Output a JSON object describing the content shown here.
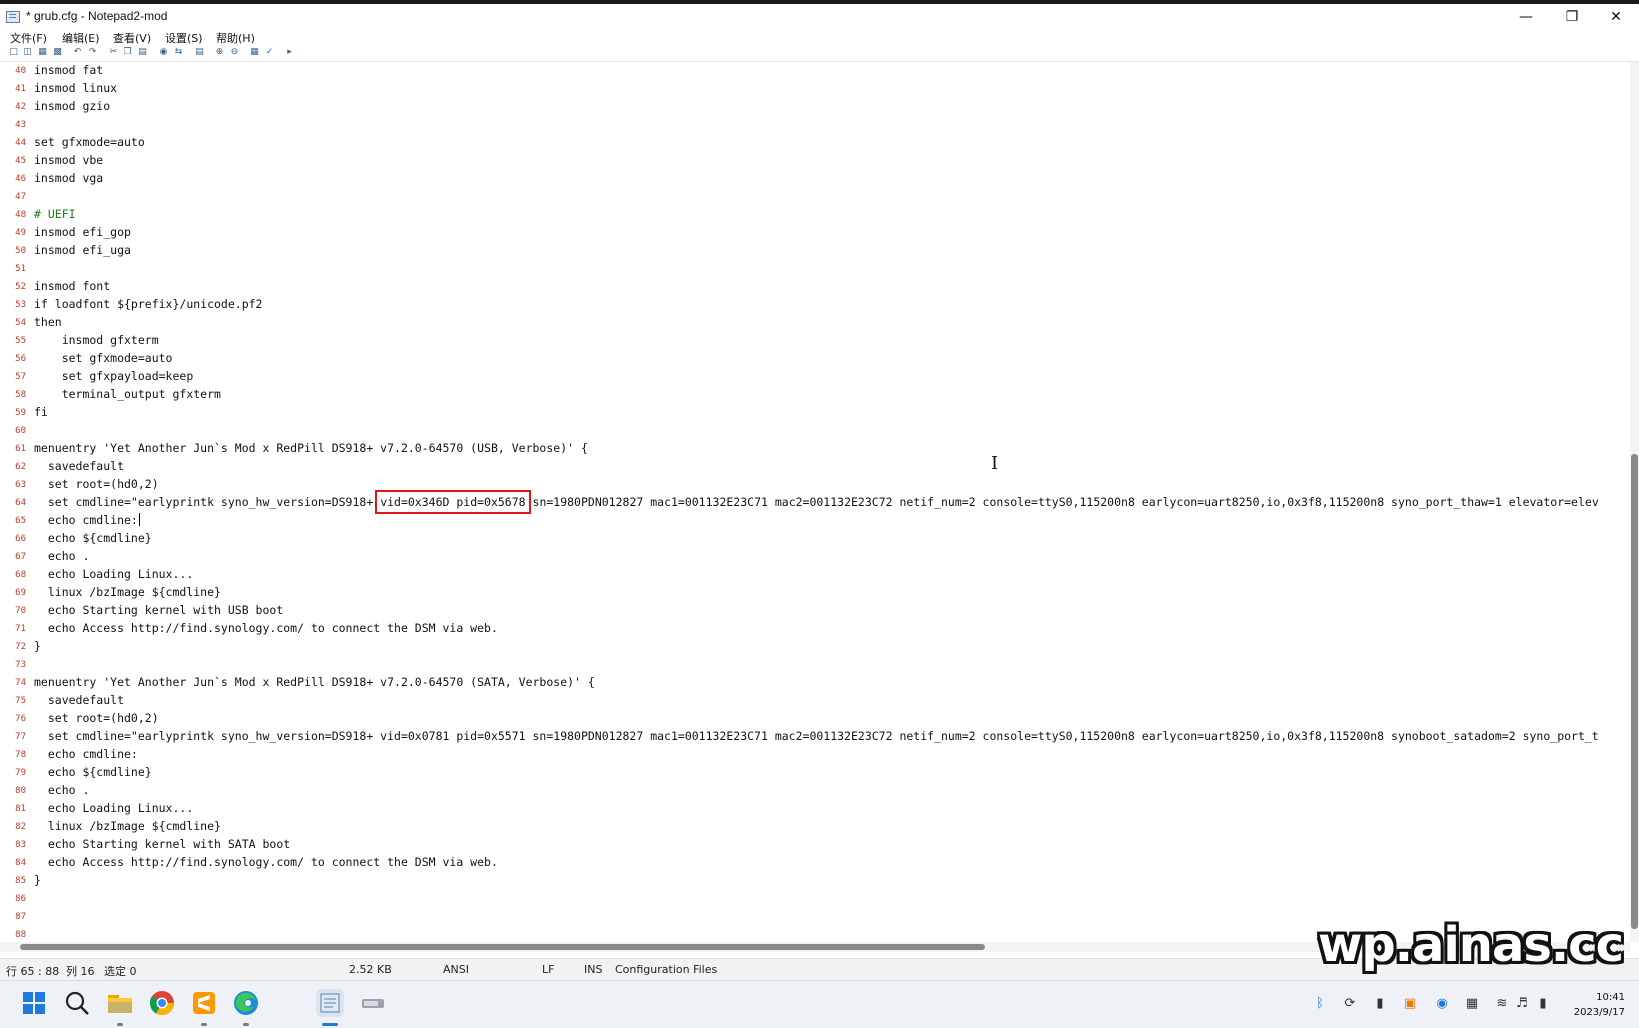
{
  "window": {
    "title": "* grub.cfg - Notepad2-mod"
  },
  "menu": [
    "文件(F)",
    "编辑(E)",
    "查看(V)",
    "设置(S)",
    "帮助(H)"
  ],
  "lines": [
    {
      "n": "40",
      "t": "insmod fat"
    },
    {
      "n": "41",
      "t": "insmod linux"
    },
    {
      "n": "42",
      "t": "insmod gzio"
    },
    {
      "n": "43",
      "t": ""
    },
    {
      "n": "44",
      "t": "set gfxmode=auto"
    },
    {
      "n": "45",
      "t": "insmod vbe"
    },
    {
      "n": "46",
      "t": "insmod vga"
    },
    {
      "n": "47",
      "t": ""
    },
    {
      "n": "48",
      "t": "# UEFI",
      "comment": true
    },
    {
      "n": "49",
      "t": "insmod efi_gop"
    },
    {
      "n": "50",
      "t": "insmod efi_uga"
    },
    {
      "n": "51",
      "t": ""
    },
    {
      "n": "52",
      "t": "insmod font"
    },
    {
      "n": "53",
      "t": "if loadfont ${prefix}/unicode.pf2"
    },
    {
      "n": "54",
      "t": "then"
    },
    {
      "n": "55",
      "t": "    insmod gfxterm"
    },
    {
      "n": "56",
      "t": "    set gfxmode=auto"
    },
    {
      "n": "57",
      "t": "    set gfxpayload=keep"
    },
    {
      "n": "58",
      "t": "    terminal_output gfxterm"
    },
    {
      "n": "59",
      "t": "fi"
    },
    {
      "n": "60",
      "t": ""
    },
    {
      "n": "61",
      "t": "menuentry 'Yet Another Jun`s Mod x RedPill DS918+ v7.2.0-64570 (USB, Verbose)' {"
    },
    {
      "n": "62",
      "t": "  savedefault"
    },
    {
      "n": "63",
      "t": "  set root=(hd0,2)"
    },
    {
      "n": "64",
      "t": "  set cmdline=\"earlyprintk syno_hw_version=DS918+ ",
      "hl": "vid=0x346D pid=0x5678",
      "after": " sn=1980PDN012827 mac1=001132E23C71 mac2=001132E23C72 netif_num=2 console=ttyS0,115200n8 earlycon=uart8250,io,0x3f8,115200n8 syno_port_thaw=1 elevator=elev"
    },
    {
      "n": "65",
      "t": "  echo cmdline:",
      "caret": true
    },
    {
      "n": "66",
      "t": "  echo ${cmdline}"
    },
    {
      "n": "67",
      "t": "  echo ."
    },
    {
      "n": "68",
      "t": "  echo Loading Linux..."
    },
    {
      "n": "69",
      "t": "  linux /bzImage ${cmdline}"
    },
    {
      "n": "70",
      "t": "  echo Starting kernel with USB boot"
    },
    {
      "n": "71",
      "t": "  echo Access http://find.synology.com/ to connect the DSM via web."
    },
    {
      "n": "72",
      "t": "}"
    },
    {
      "n": "73",
      "t": ""
    },
    {
      "n": "74",
      "t": "menuentry 'Yet Another Jun`s Mod x RedPill DS918+ v7.2.0-64570 (SATA, Verbose)' {"
    },
    {
      "n": "75",
      "t": "  savedefault"
    },
    {
      "n": "76",
      "t": "  set root=(hd0,2)"
    },
    {
      "n": "77",
      "t": "  set cmdline=\"earlyprintk syno_hw_version=DS918+ vid=0x0781 pid=0x5571 sn=1980PDN012827 mac1=001132E23C71 mac2=001132E23C72 netif_num=2 console=ttyS0,115200n8 earlycon=uart8250,io,0x3f8,115200n8 synoboot_satadom=2 syno_port_t"
    },
    {
      "n": "78",
      "t": "  echo cmdline:"
    },
    {
      "n": "79",
      "t": "  echo ${cmdline}"
    },
    {
      "n": "80",
      "t": "  echo ."
    },
    {
      "n": "81",
      "t": "  echo Loading Linux..."
    },
    {
      "n": "82",
      "t": "  linux /bzImage ${cmdline}"
    },
    {
      "n": "83",
      "t": "  echo Starting kernel with SATA boot"
    },
    {
      "n": "84",
      "t": "  echo Access http://find.synology.com/ to connect the DSM via web."
    },
    {
      "n": "85",
      "t": "}"
    },
    {
      "n": "86",
      "t": ""
    },
    {
      "n": "87",
      "t": ""
    },
    {
      "n": "88",
      "t": ""
    }
  ],
  "status": {
    "position": "行 65 : 88",
    "column": "列 16",
    "selection": "选定 0",
    "size": "2.52 KB",
    "encoding": "ANSI",
    "eol": "LF",
    "mode": "INS",
    "scheme": "Configuration Files"
  },
  "watermark": "wp.ainas.cc",
  "clock": {
    "time": "10:41",
    "date": "2023/9/17"
  },
  "colors": {
    "line_number": "#c0392b",
    "highlight_box": "#e0161c",
    "comment": "#1a7f1a"
  }
}
